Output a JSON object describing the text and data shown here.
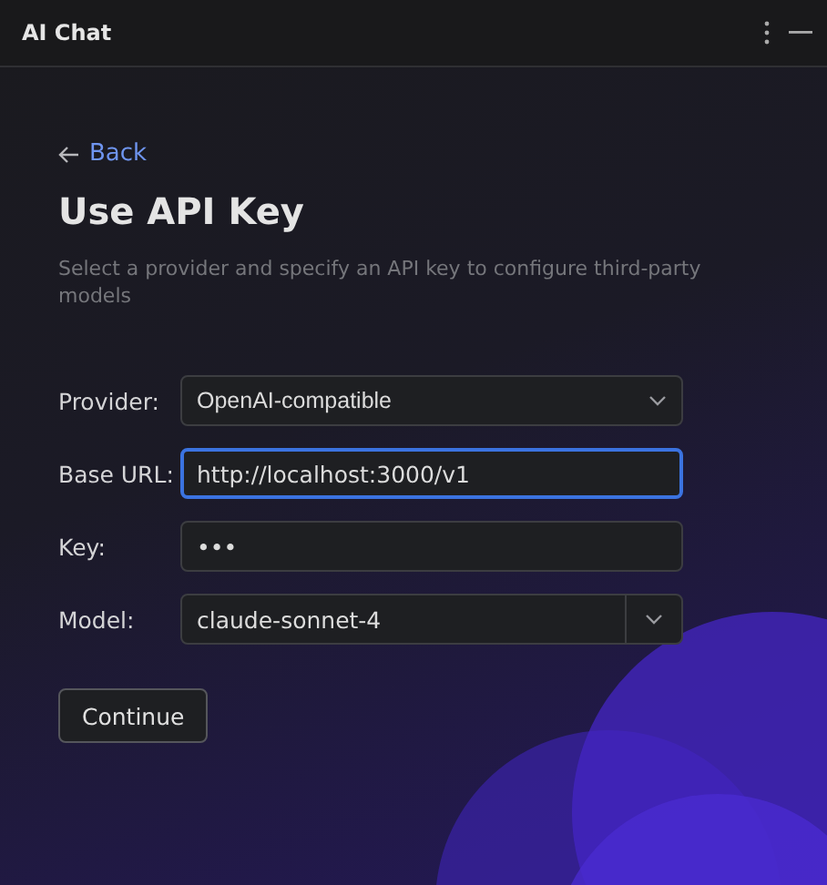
{
  "window": {
    "title": "AI Chat"
  },
  "back": {
    "label": "Back"
  },
  "heading": "Use API Key",
  "description": "Select a provider and specify an API key to configure third-party models",
  "fields": [
    {
      "label": "Provider:",
      "kind": "dropdown",
      "value": "OpenAI-compatible",
      "focused": false
    },
    {
      "label": "Base URL:",
      "kind": "text",
      "value": "http://localhost:3000/v1",
      "focused": true
    },
    {
      "label": "Key:",
      "kind": "text",
      "value": "•••",
      "focused": false
    },
    {
      "label": "Model:",
      "kind": "combo",
      "value": "claude-sonnet-4",
      "focused": false
    }
  ],
  "buttons": [
    "Continue"
  ]
}
